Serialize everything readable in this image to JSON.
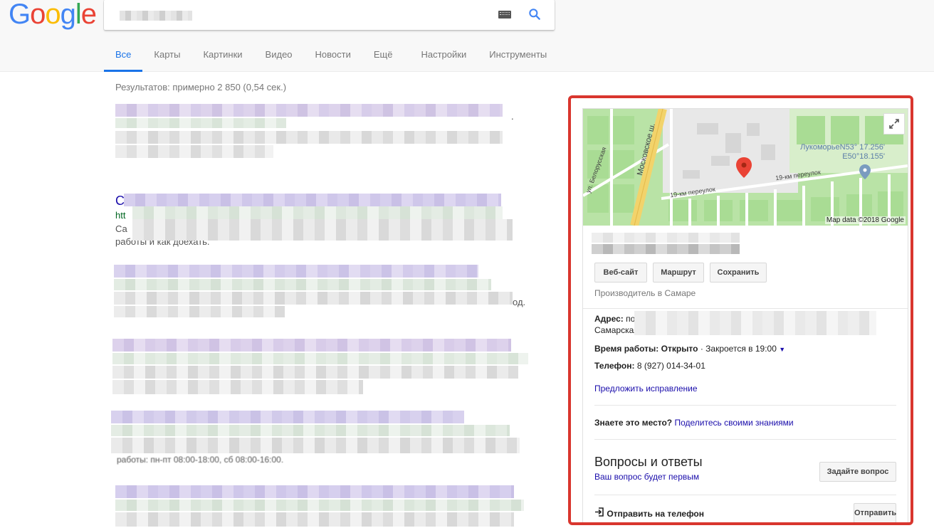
{
  "logo": {
    "text": "Google"
  },
  "search": {
    "keyboard_icon": "keyboard-icon",
    "search_icon": "search-icon"
  },
  "tabs": [
    {
      "label": "Все",
      "active": true
    },
    {
      "label": "Карты"
    },
    {
      "label": "Картинки"
    },
    {
      "label": "Видео"
    },
    {
      "label": "Новости"
    },
    {
      "label": "Ещё"
    },
    {
      "label": "Настройки"
    },
    {
      "label": "Инструменты"
    }
  ],
  "results_stats": "Результатов: примерно 2 850 (0,54 сек.)",
  "result_fragments": {
    "r2_title_char": "С",
    "r2_url_char": "htt",
    "r2_snip_char": "Са",
    "r2_snip_tail": "работы и как доехать.",
    "r3_tail": "од.",
    "r5_tail": "работы: пн-пт 08:00-18:00, сб 08:00-16:00.",
    "r1_tail": "."
  },
  "map": {
    "credit": "Map data ©2018 Google",
    "street_main": "Московское ш.",
    "street_lane": "19-км переулок",
    "street_lane2": "19-км переулок",
    "street_side": "ул. Белорусская",
    "place": "ЛукоморьеN53° 17.256' E50°18.155'",
    "expand_icon": "expand-icon",
    "pin_icon": "map-pin-icon"
  },
  "kp": {
    "buttons": {
      "website": "Веб-сайт",
      "route": "Маршрут",
      "save": "Сохранить"
    },
    "category": "Производитель в Самаре",
    "address_label": "Адрес:",
    "address_value": "по",
    "address_line2": "Самарская обл., 443082",
    "hours_label": "Время работы:",
    "hours_status": "Открыто",
    "hours_detail": "· Закроется в 19:00",
    "phone_label": "Телефон:",
    "phone_value": "8 (927) 014-34-01",
    "suggest_edit": "Предложить исправление",
    "know_label": "Знаете это место?",
    "know_link": "Поделитесь своими знаниями",
    "qa_title": "Вопросы и ответы",
    "qa_sub": "Ваш вопрос будет первым",
    "qa_button": "Задайте вопрос",
    "send_label": "Отправить на телефон",
    "send_button": "Отправить"
  }
}
